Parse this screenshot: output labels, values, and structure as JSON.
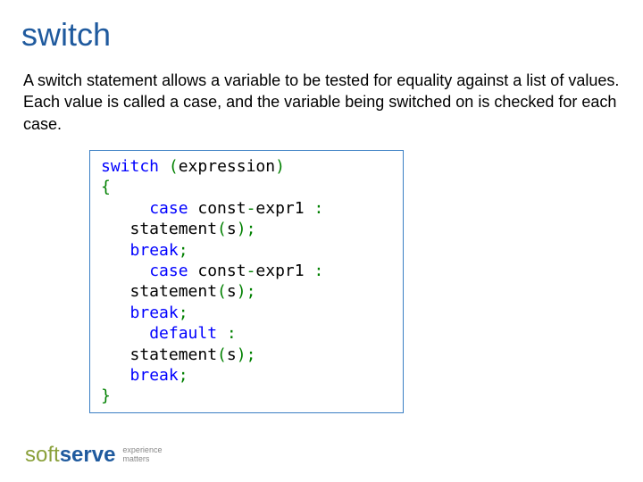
{
  "title": "switch",
  "description": "A switch statement allows a variable to be tested for equality against a list of values. Each value is called a case, and the variable being switched on is checked for each case.",
  "code": {
    "t1": "switch",
    "t2": " (",
    "t3": "expression",
    "t4": ")",
    "t5": "",
    "t6": "{",
    "t7": "",
    "t8": "     ",
    "t9": "case",
    "t10": " const",
    "t11": "-",
    "t12": "expr1 ",
    "t13": ":",
    "t14": "",
    "t15": "   statement",
    "t16": "(",
    "t17": "s",
    "t18": ");",
    "t19": "",
    "t20": "   ",
    "t21": "break",
    "t22": ";",
    "t23": "",
    "t24": "     ",
    "t25": "case",
    "t26": " const",
    "t27": "-",
    "t28": "expr1 ",
    "t29": ":",
    "t30": "",
    "t31": "   statement",
    "t32": "(",
    "t33": "s",
    "t34": ");",
    "t35": "",
    "t36": "   ",
    "t37": "break",
    "t38": ";",
    "t39": "",
    "t40": "     ",
    "t41": "default",
    "t42": " ",
    "t43": ":",
    "t44": "",
    "t45": "   statement",
    "t46": "(",
    "t47": "s",
    "t48": ");",
    "t49": "",
    "t50": "   ",
    "t51": "break",
    "t52": ";",
    "t53": "",
    "t54": "}"
  },
  "logo": {
    "soft": "soft",
    "serve": "serve",
    "tagline1": "experience",
    "tagline2": "matters"
  }
}
